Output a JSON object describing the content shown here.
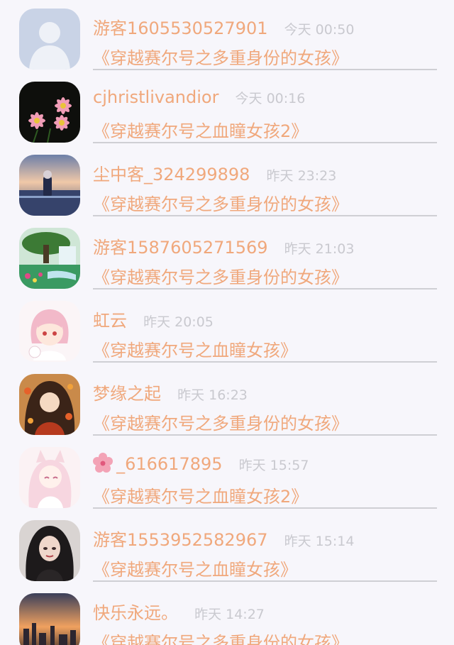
{
  "colors": {
    "accent": "#f0a87c",
    "time": "#c9c9cf",
    "background": "#f7f6fb"
  },
  "items": [
    {
      "user": "游客1605530527901",
      "time": "今天 00:50",
      "book": "《穿越赛尔号之多重身份的女孩》",
      "avatar": "default-person"
    },
    {
      "user": "cjhristlivandior",
      "time": "今天 00:16",
      "book": "《穿越赛尔号之血瞳女孩2》",
      "avatar": "pink-daisies"
    },
    {
      "user": "尘中客_324299898",
      "time": "昨天 23:23",
      "book": "《穿越赛尔号之多重身份的女孩》",
      "avatar": "anime-sky"
    },
    {
      "user": "游客1587605271569",
      "time": "昨天 21:03",
      "book": "《穿越赛尔号之多重身份的女孩》",
      "avatar": "nature-waterfall"
    },
    {
      "user": "虹云",
      "time": "昨天 20:05",
      "book": "《穿越赛尔号之血瞳女孩》",
      "avatar": "chibi-pink-girl"
    },
    {
      "user": "梦缘之起",
      "time": "昨天 16:23",
      "book": "《穿越赛尔号之多重身份的女孩》",
      "avatar": "autumn-anime-girl"
    },
    {
      "user": "_616617895",
      "time": "昨天 15:57",
      "book": "《穿越赛尔号之血瞳女孩2》",
      "avatar": "white-fox-girl",
      "user_icon": "cherry-blossom"
    },
    {
      "user": "游客1553952582967",
      "time": "昨天 15:14",
      "book": "《穿越赛尔号之血瞳女孩》",
      "avatar": "dark-hair-portrait"
    },
    {
      "user": "快乐永远。",
      "time": "昨天 14:27",
      "book": "《穿越赛尔号之多重身份的女孩》",
      "avatar": "city-sunset"
    }
  ]
}
